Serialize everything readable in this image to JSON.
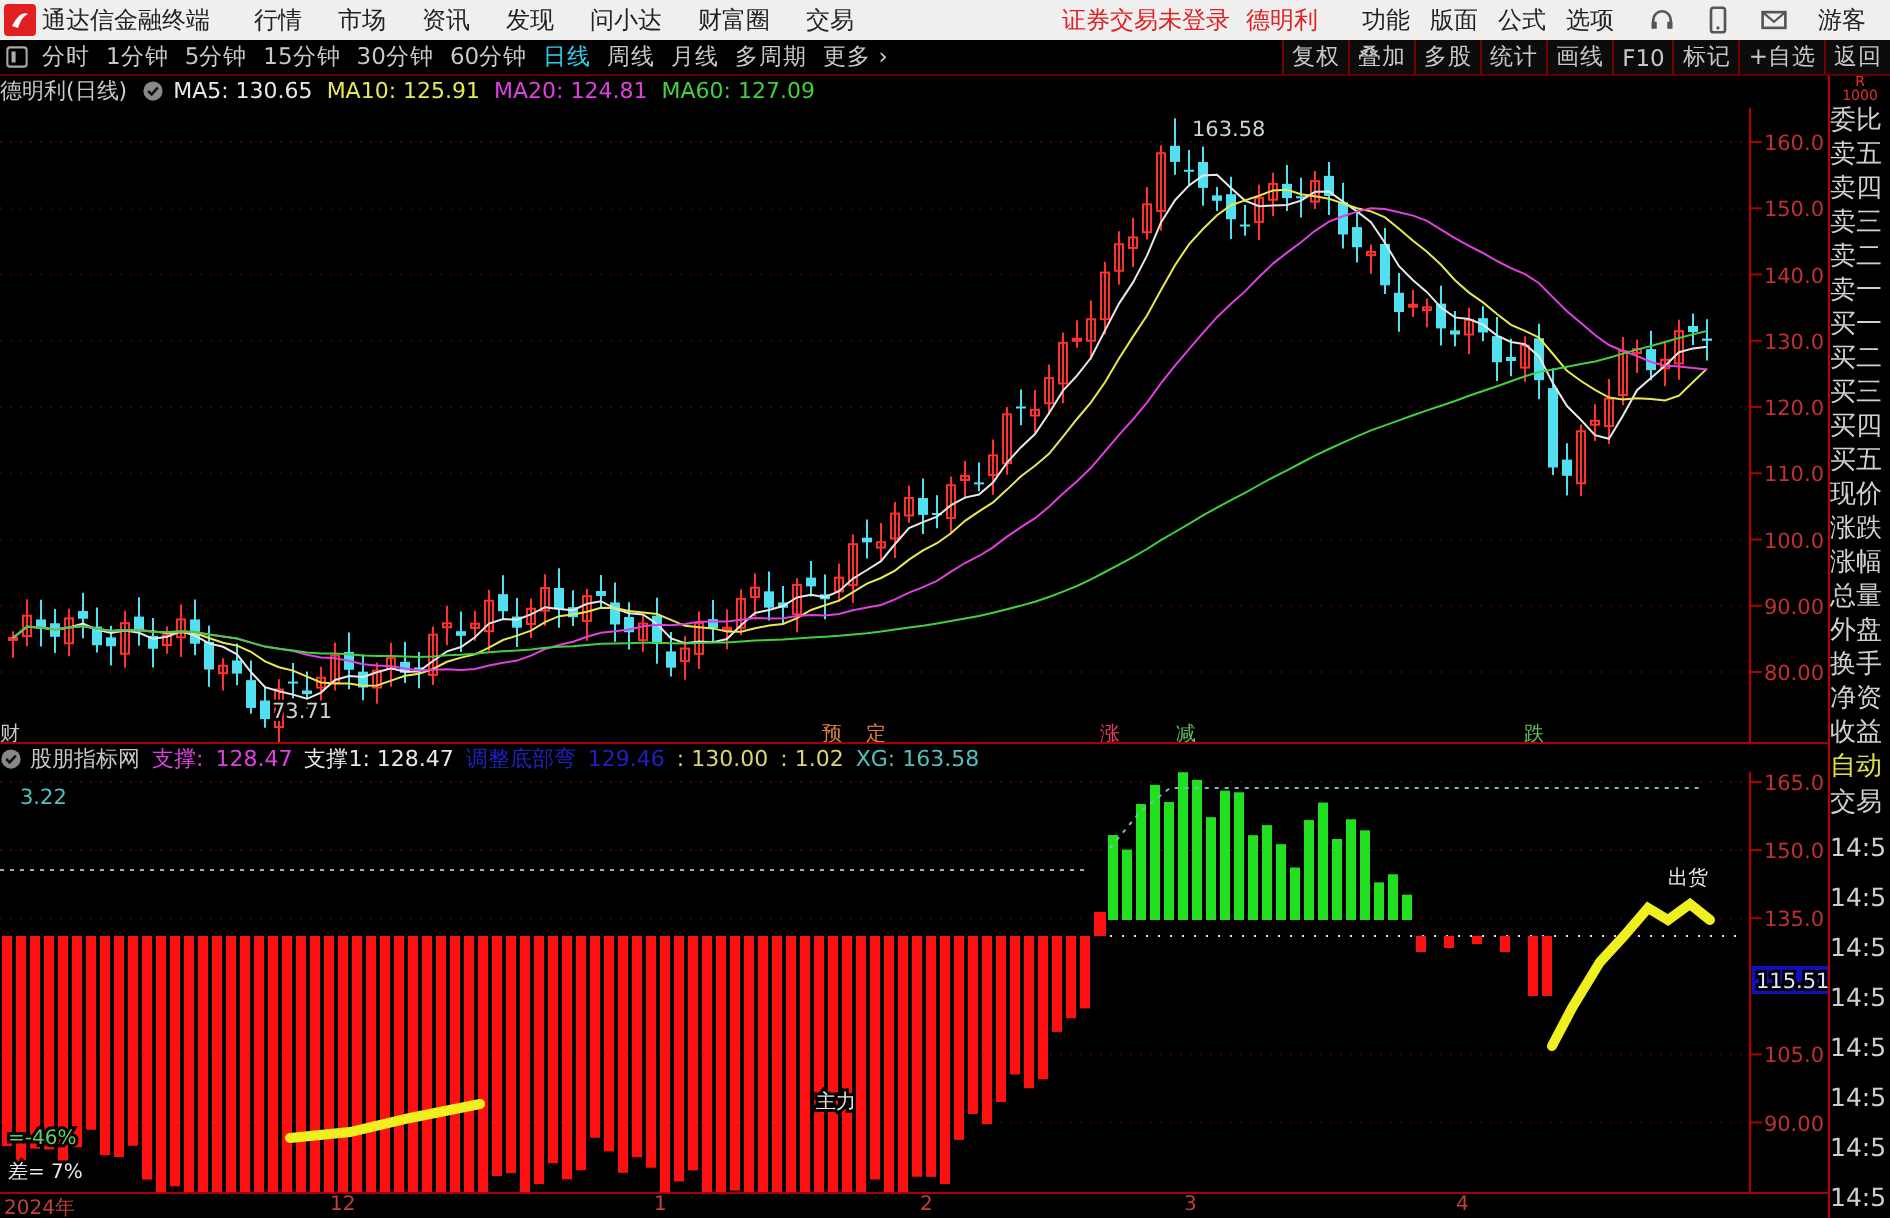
{
  "app": {
    "title": "通达信金融终端",
    "menu": [
      "行情",
      "市场",
      "资讯",
      "发现",
      "问小达",
      "财富圈",
      "交易"
    ],
    "login_notice": "证券交易未登录",
    "stock_name": "德明利",
    "right_menu": [
      "功能",
      "版面",
      "公式",
      "选项"
    ],
    "user": "游客"
  },
  "period_bar": {
    "periods": [
      {
        "label": "分时",
        "selected": false
      },
      {
        "label": "1分钟",
        "selected": false
      },
      {
        "label": "5分钟",
        "selected": false
      },
      {
        "label": "15分钟",
        "selected": false
      },
      {
        "label": "30分钟",
        "selected": false
      },
      {
        "label": "60分钟",
        "selected": false
      },
      {
        "label": "日线",
        "selected": true
      },
      {
        "label": "周线",
        "selected": false
      },
      {
        "label": "月线",
        "selected": false
      },
      {
        "label": "多周期",
        "selected": false
      },
      {
        "label": "更多 ›",
        "selected": false
      }
    ],
    "tools": [
      "复权",
      "叠加",
      "多股",
      "统计",
      "画线",
      "F10",
      "标记",
      "+自选",
      "返回"
    ]
  },
  "main_chart": {
    "title": "德明利(日线)",
    "indicators": [
      {
        "label": "MA5: 130.65",
        "color": "#e8e8e8"
      },
      {
        "label": "MA10: 125.91",
        "color": "#e8e850"
      },
      {
        "label": "MA20: 124.81",
        "color": "#e040e0"
      },
      {
        "label": "MA60: 127.09",
        "color": "#40d040"
      }
    ],
    "y_labels": [
      "160.0",
      "150.0",
      "140.0",
      "130.0",
      "120.0",
      "110.0",
      "100.0",
      "90.00",
      "80.00"
    ],
    "high_label": "163.58",
    "low_label": "73.71",
    "signals": [
      {
        "text": "财",
        "color": "#c8c8c8"
      },
      {
        "text": "预",
        "color": "#e08040"
      },
      {
        "text": "定",
        "color": "#e08040"
      },
      {
        "text": "涨",
        "color": "#e04060"
      },
      {
        "text": "减",
        "color": "#60c060"
      },
      {
        "text": "跌",
        "color": "#60c060"
      }
    ]
  },
  "sub_chart": {
    "title": "股朋指标网",
    "readouts": [
      {
        "label": "支撑:",
        "color": "#e040e0"
      },
      {
        "label": "128.47",
        "color": "#e040e0"
      },
      {
        "label": "支撑1: 128.47",
        "color": "#e8e8e8"
      },
      {
        "label": "调整底部弯",
        "color": "#2020c0"
      },
      {
        "label": "129.46",
        "color": "#2020c0"
      },
      {
        "label": ": 130.00",
        "color": "#d8d870"
      },
      {
        "label": ": 1.02",
        "color": "#d8d870"
      },
      {
        "label": "XG: 163.58",
        "color": "#50c0c0"
      }
    ],
    "top_value": "3.22",
    "y_labels": [
      "165.0",
      "150.0",
      "135.0",
      "105.0",
      "90.00"
    ],
    "current_label": "115.51",
    "annotations": [
      {
        "text": "=-46%",
        "color": "#60d060"
      },
      {
        "text": "差= 7%",
        "color": "#e8e8e8"
      },
      {
        "text": "主力",
        "color": "#e8e8e8"
      },
      {
        "text": "出货",
        "color": "#e8e8e8"
      }
    ]
  },
  "quote_panel": {
    "badge": "R",
    "badge_sub": "1000",
    "labels": [
      "委比",
      "卖五",
      "卖四",
      "卖三",
      "卖二",
      "卖一",
      "买一",
      "买二",
      "买三",
      "买四",
      "买五",
      "现价",
      "涨跌",
      "涨幅",
      "总量",
      "外盘",
      "换手",
      "净资",
      "收益"
    ],
    "mode": "自动",
    "trade": "交易",
    "times": [
      "14:5",
      "14:5",
      "14:5",
      "14:5",
      "14:5",
      "14:5",
      "14:5",
      "14:5"
    ]
  },
  "time_axis": [
    "2024年",
    "12",
    "1",
    "2",
    "3",
    "4"
  ]
}
